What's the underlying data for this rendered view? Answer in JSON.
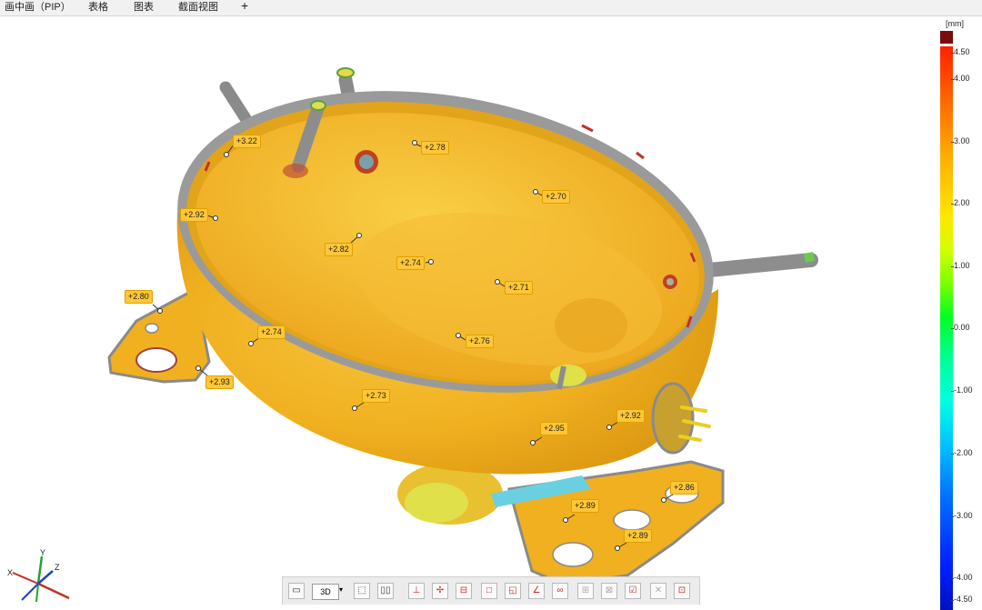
{
  "tabs": [
    {
      "label": "画中画（PIP）"
    },
    {
      "label": "表格"
    },
    {
      "label": "图表"
    },
    {
      "label": "截面视图"
    }
  ],
  "tab_add": "+",
  "color_scale": {
    "unit": "[mm]",
    "ticks": [
      "4.50",
      "4.00",
      "3.00",
      "2.00",
      "1.00",
      "0.00",
      "-1.00",
      "-2.00",
      "-3.00",
      "-4.00",
      "-4.50"
    ],
    "overmax_color": "#7a0c0c"
  },
  "annotations": [
    "+3.22",
    "+2.78",
    "+2.70",
    "+2.92",
    "+2.82",
    "+2.74",
    "+2.71",
    "+2.80",
    "+2.74",
    "+2.76",
    "+2.93",
    "+2.73",
    "+2.95",
    "+2.92",
    "+2.86",
    "+2.89",
    "+2.89"
  ],
  "view_mode": "3D",
  "axes": {
    "x": "X",
    "y": "Y",
    "z": "Z"
  },
  "toolbar": {
    "icons": [
      "display-icon",
      "mode-3d-icon",
      "select-rect-icon",
      "split-view-icon",
      "point-icon",
      "align-icon",
      "section-icon",
      "square-icon",
      "chart-icon",
      "angle-icon",
      "link-icon",
      "grid-icon",
      "delete-icon",
      "check-icon",
      "cross-icon",
      "layout-icon"
    ]
  }
}
